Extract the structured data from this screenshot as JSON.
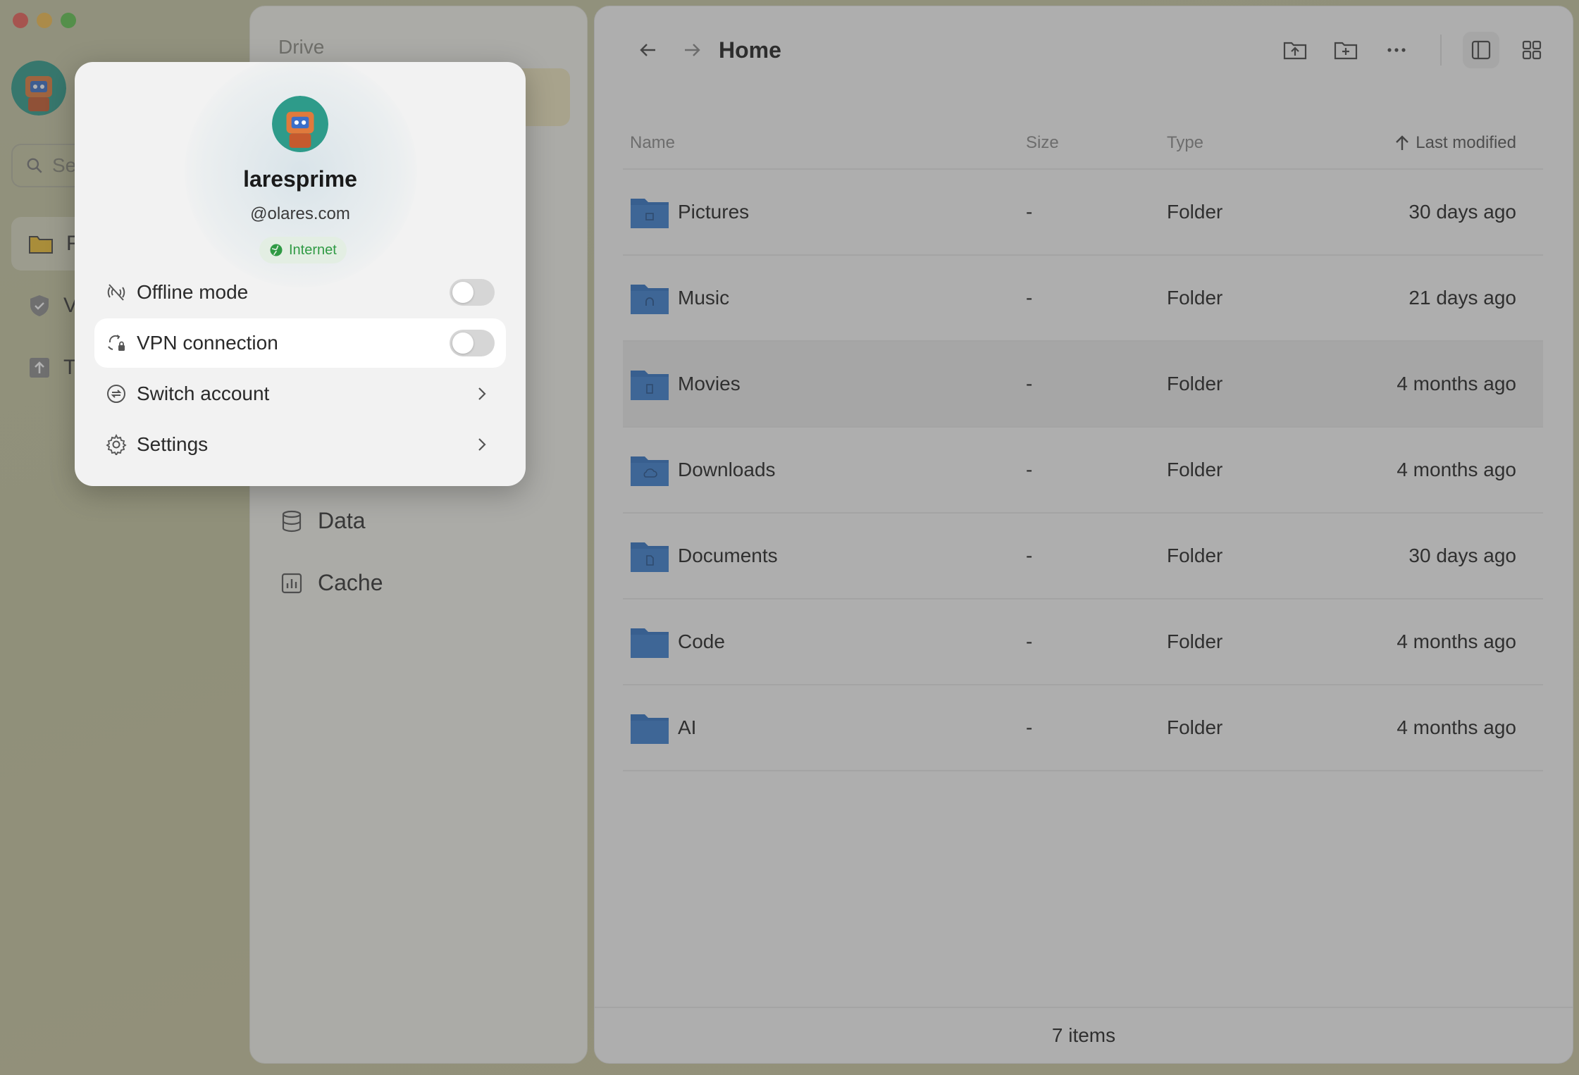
{
  "rail": {
    "search_placeholder": "Se",
    "items": [
      {
        "label": "F",
        "icon": "folder-icon"
      },
      {
        "label": "V",
        "icon": "shield-icon"
      },
      {
        "label": "T",
        "icon": "upload-icon"
      }
    ]
  },
  "middle": {
    "title": "Drive",
    "items": [
      {
        "label": "Data",
        "icon": "database-icon"
      },
      {
        "label": "Cache",
        "icon": "cache-icon"
      }
    ]
  },
  "main": {
    "breadcrumb": "Home",
    "columns": {
      "name": "Name",
      "size": "Size",
      "type": "Type",
      "modified": "Last modified"
    },
    "rows": [
      {
        "name": "Pictures",
        "size": "-",
        "type": "Folder",
        "modified": "30 days ago",
        "icon": "image-folder-icon"
      },
      {
        "name": "Music",
        "size": "-",
        "type": "Folder",
        "modified": "21 days ago",
        "icon": "music-folder-icon"
      },
      {
        "name": "Movies",
        "size": "-",
        "type": "Folder",
        "modified": "4 months ago",
        "icon": "movie-folder-icon"
      },
      {
        "name": "Downloads",
        "size": "-",
        "type": "Folder",
        "modified": "4 months ago",
        "icon": "download-folder-icon"
      },
      {
        "name": "Documents",
        "size": "-",
        "type": "Folder",
        "modified": "30 days ago",
        "icon": "document-folder-icon"
      },
      {
        "name": "Code",
        "size": "-",
        "type": "Folder",
        "modified": "4 months ago",
        "icon": "folder-icon"
      },
      {
        "name": "AI",
        "size": "-",
        "type": "Folder",
        "modified": "4 months ago",
        "icon": "folder-icon"
      }
    ],
    "footer": "7 items"
  },
  "popover": {
    "username": "laresprime",
    "domain": "@olares.com",
    "status": "Internet",
    "offline_mode": "Offline mode",
    "vpn": "VPN connection",
    "switch_account": "Switch account",
    "settings": "Settings"
  },
  "colors": {
    "folder": "#2f72c4",
    "badge_green": "#2f9a44",
    "overlay": "rgba(70,70,70,0.42)"
  }
}
